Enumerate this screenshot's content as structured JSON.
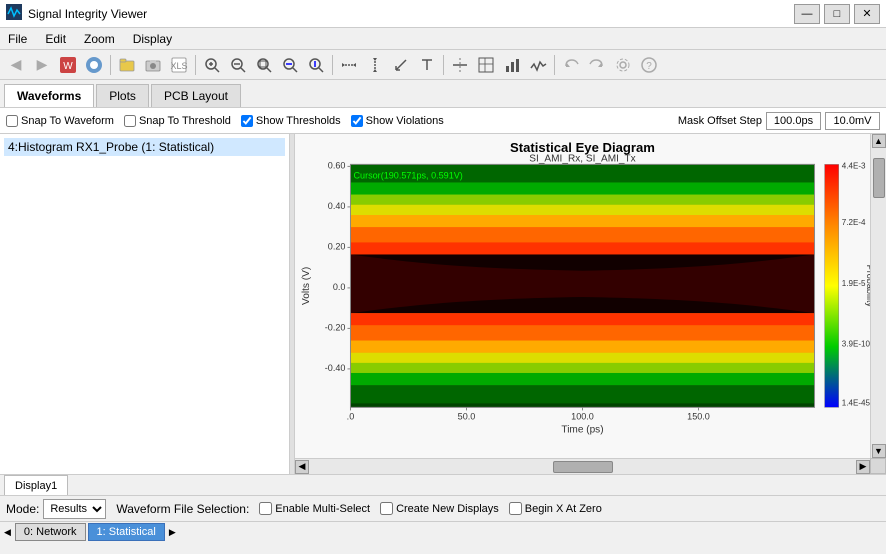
{
  "app": {
    "title": "Signal Integrity Viewer",
    "icon": "📊"
  },
  "title_controls": {
    "minimize": "—",
    "maximize": "□",
    "close": "✕"
  },
  "menu": {
    "items": [
      "File",
      "Edit",
      "Zoom",
      "Display"
    ]
  },
  "toolbar": {
    "buttons": [
      {
        "name": "open",
        "icon": "📂"
      },
      {
        "name": "save",
        "icon": "💾"
      },
      {
        "name": "print",
        "icon": "🖨"
      },
      {
        "name": "zoom-in",
        "icon": "🔍"
      },
      {
        "name": "zoom-out",
        "icon": "🔎"
      }
    ]
  },
  "main_tabs": {
    "tabs": [
      {
        "label": "Waveforms",
        "active": true
      },
      {
        "label": "Plots",
        "active": false
      },
      {
        "label": "PCB Layout",
        "active": false
      }
    ]
  },
  "options": {
    "snap_to_waveform": {
      "label": "Snap To Waveform",
      "checked": false
    },
    "snap_to_threshold": {
      "label": "Snap To Threshold",
      "checked": false
    },
    "show_thresholds": {
      "label": "Show Thresholds",
      "checked": true
    },
    "show_violations": {
      "label": "Show Violations",
      "checked": true
    },
    "mask_offset_label": "Mask Offset Step",
    "mask_offset_time": "100.0ps",
    "mask_offset_voltage": "10.0mV"
  },
  "tree": {
    "items": [
      {
        "label": "4:Histogram RX1_Probe  (1: Statistical)",
        "selected": true
      }
    ]
  },
  "eye_diagram": {
    "title": "Statistical Eye Diagram",
    "subtitle": "SI_AMI_Rx, SI_AMI_Tx",
    "cursor": "Cursor(190.571ps, 0.591V)",
    "x_label": "Time (ps)",
    "y_label": "Volts (V)",
    "x_ticks": [
      "0",
      "50.0",
      "100.0",
      "150.0"
    ],
    "y_ticks": [
      "0.60",
      "0.40",
      "0.20",
      "0.0",
      "-0.20",
      "-0.40"
    ],
    "colorbar": {
      "label": "Probability",
      "ticks": [
        "4.4E-3",
        "7.2E-4",
        "1.9E-5",
        "3.9E-10",
        "1.4E-45"
      ]
    },
    "colors": {
      "high": "#ff0000",
      "mid_high": "#ff8000",
      "mid": "#ffff00",
      "mid_low": "#00ff00",
      "low": "#0000ff",
      "background": "#000080"
    }
  },
  "bottom": {
    "tab_label": "Display1",
    "mode_label": "Mode:",
    "mode_value": "Results",
    "waveform_label": "Waveform File Selection:",
    "enable_multi": "Enable Multi-Select",
    "create_displays": "Create New Displays",
    "begin_x": "Begin X At Zero"
  },
  "nav_tabs": [
    {
      "label": "0: Network",
      "active": false
    },
    {
      "label": "1: Statistical",
      "active": true
    }
  ]
}
